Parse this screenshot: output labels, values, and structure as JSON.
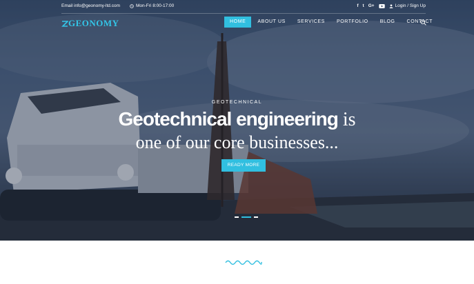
{
  "topbar": {
    "email": "Email info@geonomy-ltd.com",
    "hours": "Mon-Fri 8:00-17:00",
    "social": [
      "f",
      "t",
      "G+"
    ],
    "login": "Login / Sign Up"
  },
  "logo": {
    "text": "GEONOMY"
  },
  "nav": {
    "items": [
      "HOME",
      "ABOUT US",
      "SERVICES",
      "PORTFOLIO",
      "BLOG",
      "CONTACT"
    ],
    "active": "HOME"
  },
  "hero": {
    "eyebrow": "GEOTECHNICAL",
    "headline_bold": "Geotechnical engineering",
    "headline_light": " is",
    "headline_line2": "one of our core businesses...",
    "button": "READY MORE"
  },
  "slider": {
    "total": 3,
    "active": 2
  },
  "colors": {
    "accent": "#31bfe0",
    "logo": "#33c6e8"
  }
}
